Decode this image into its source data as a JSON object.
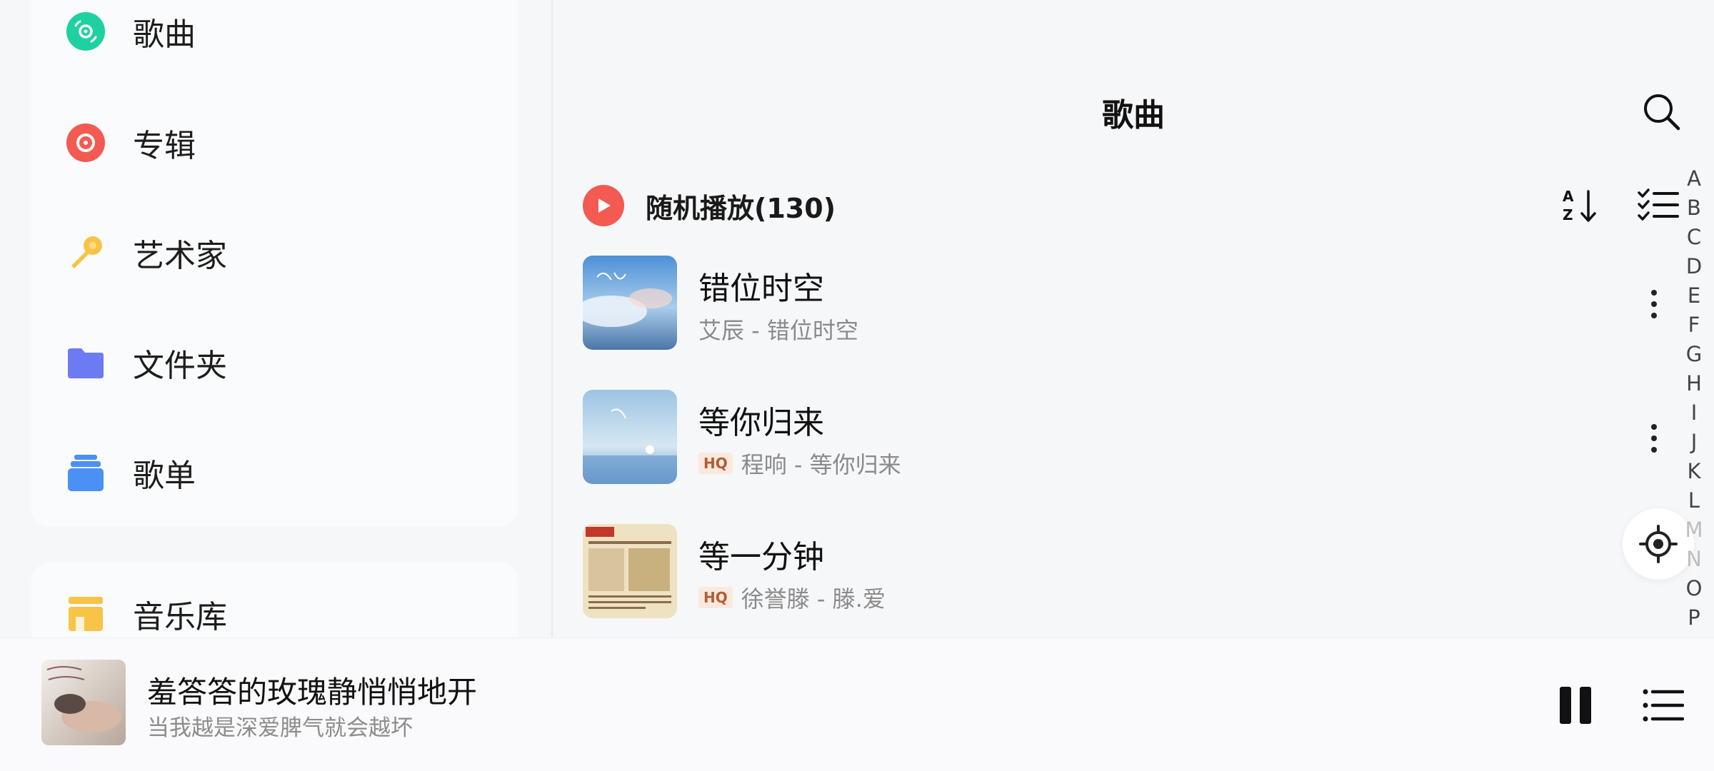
{
  "nav": {
    "items": [
      {
        "label": "歌曲",
        "icon": "disc-icon"
      },
      {
        "label": "专辑",
        "icon": "album-icon"
      },
      {
        "label": "艺术家",
        "icon": "microphone-icon"
      },
      {
        "label": "文件夹",
        "icon": "folder-icon"
      },
      {
        "label": "歌单",
        "icon": "playlist-stack-icon"
      },
      {
        "label": "音乐库",
        "icon": "store-icon"
      }
    ]
  },
  "header": {
    "title": "歌曲",
    "search_icon": "search-icon"
  },
  "shuffle": {
    "label": "随机播放(130)",
    "sort_icon": "sort-az-icon",
    "multiselect_icon": "checklist-icon"
  },
  "songs": [
    {
      "title": "错位时空",
      "subtitle": "艾辰 - 错位时空",
      "hq": false
    },
    {
      "title": "等你归来",
      "subtitle": "程响 - 等你归来",
      "hq": true,
      "badge": "HQ"
    },
    {
      "title": "等一分钟",
      "subtitle": "徐誉滕 - 滕.爱",
      "hq": true,
      "badge": "HQ"
    }
  ],
  "alpha_index": [
    "A",
    "B",
    "C",
    "D",
    "E",
    "F",
    "G",
    "H",
    "I",
    "J",
    "K",
    "L",
    "M",
    "N",
    "O",
    "P"
  ],
  "player": {
    "title": "羞答答的玫瑰静悄悄地开",
    "subtitle": "当我越是深爱脾气就会越坏",
    "pause_icon": "pause-icon",
    "queue_icon": "queue-list-icon"
  },
  "colors": {
    "accent_red": "#f25a52",
    "green": "#1fd1a0",
    "yellow": "#f7c447",
    "blue": "#4a90f5",
    "purple": "#6d7bf2"
  }
}
